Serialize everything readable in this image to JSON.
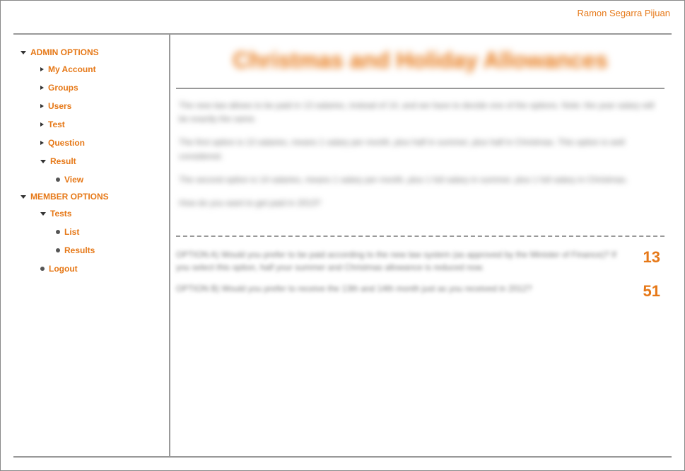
{
  "header": {
    "username": "Ramon Segarra Pijuan"
  },
  "sidebar": {
    "admin_label": "ADMIN OPTIONS",
    "admin_items": {
      "my_account": "My Account",
      "groups": "Groups",
      "users": "Users",
      "test": "Test",
      "question": "Question",
      "result": "Result",
      "view": "View"
    },
    "member_label": "MEMBER OPTIONS",
    "member_items": {
      "tests": "Tests",
      "list": "List",
      "results": "Results"
    },
    "logout": "Logout"
  },
  "main": {
    "title": "Christmas and Holiday Allowances",
    "paragraphs": {
      "p1": "The new law allows to be paid in 13 salaries, instead of 14, and we have to decide one of the options. Note: the year salary will be exactly the same.",
      "p2": "The first option is 13 salaries, means 1 salary per month, plus half in summer, plus half in Christmas. This option is well considered.",
      "p3": "The second option is 14 salaries, means 1 salary per month, plus 1 full salary in summer, plus 1 full salary in Christmas.",
      "p4": "How do you want to get paid in 2013?"
    },
    "options": {
      "a_text": "OPTION A) Would you prefer to be paid according to the new law system (as approved by the Minister of Finance)? If you select this option, half your summer and Christmas allowance is reduced now.",
      "a_count": "13",
      "b_text": "OPTION B) Would you prefer to receive the 13th and 14th month just as you received in 2012?",
      "b_count": "51"
    }
  }
}
